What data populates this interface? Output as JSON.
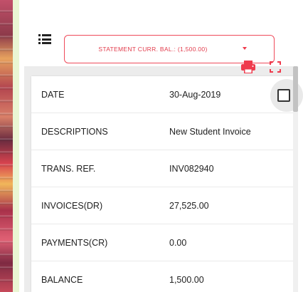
{
  "statement": {
    "selected_label": "STATEMENT CURR. BAL.: (1,500.00)"
  },
  "colors": {
    "accent": "#ef4a5a"
  },
  "icons": {
    "list": "list-view-icon",
    "print": "printer-icon",
    "fullscreen": "fullscreen-icon",
    "caret": "caret-down-icon"
  },
  "details": [
    {
      "label": "DATE",
      "value": "30-Aug-2019"
    },
    {
      "label": "DESCRIPTIONS",
      "value": "New Student Invoice"
    },
    {
      "label": "TRANS. REF.",
      "value": "INV082940"
    },
    {
      "label": "INVOICES(DR)",
      "value": "27,525.00"
    },
    {
      "label": "PAYMENTS(CR)",
      "value": "0.00"
    },
    {
      "label": "BALANCE",
      "value": "1,500.00"
    }
  ]
}
